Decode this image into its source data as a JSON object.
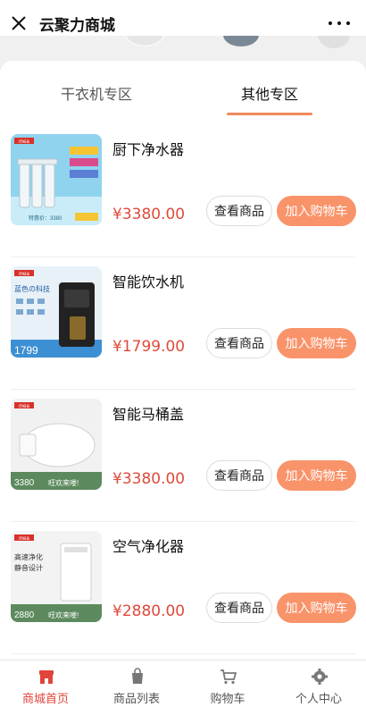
{
  "topbar": {
    "title": "云聚力商城"
  },
  "tabs": [
    {
      "label": "干衣机专区",
      "active": false
    },
    {
      "label": "其他专区",
      "active": true
    }
  ],
  "products": [
    {
      "name": "厨下净水器",
      "price": "¥3380.00",
      "view_label": "查看商品",
      "cart_label": "加入购物车",
      "thumb_icon": "water-purifier-image"
    },
    {
      "name": "智能饮水机",
      "price": "¥1799.00",
      "view_label": "查看商品",
      "cart_label": "加入购物车",
      "thumb_icon": "water-dispenser-image"
    },
    {
      "name": "智能马桶盖",
      "price": "¥3380.00",
      "view_label": "查看商品",
      "cart_label": "加入购物车",
      "thumb_icon": "toilet-seat-image"
    },
    {
      "name": "空气净化器",
      "price": "¥2880.00",
      "view_label": "查看商品",
      "cart_label": "加入购物车",
      "thumb_icon": "air-purifier-image"
    }
  ],
  "thumbs": {
    "p1": {
      "brand": "mea",
      "price_text": "特惠价：3380"
    },
    "p2": {
      "brand": "mea",
      "line1": "蓝色の科技",
      "price_text": "1799"
    },
    "p3": {
      "brand": "mea",
      "price_text": "3380",
      "promo": "旺欢来喽!"
    },
    "p4": {
      "brand": "mea",
      "line1": "高速净化",
      "line2": "静音设计",
      "price_text": "2880",
      "promo": "旺欢来喽!"
    }
  },
  "bottomnav": [
    {
      "label": "商城首页",
      "icon": "store-icon",
      "active": true
    },
    {
      "label": "商品列表",
      "icon": "bag-icon",
      "active": false
    },
    {
      "label": "购物车",
      "icon": "cart-icon",
      "active": false
    },
    {
      "label": "个人中心",
      "icon": "gear-icon",
      "active": false
    }
  ],
  "colors": {
    "accent": "#f9936a",
    "price": "#e04a3a",
    "tab_underline": "#f08a5d",
    "nav_active": "#e0443a"
  }
}
